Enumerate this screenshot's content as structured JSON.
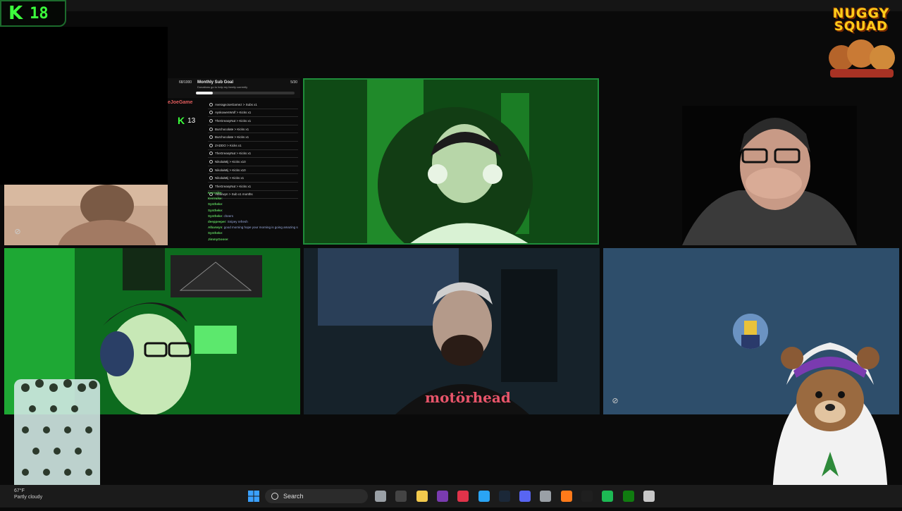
{
  "kick_badge": {
    "logo": "K",
    "value": "18"
  },
  "brand": {
    "line1": "NUGGY",
    "line2": "SQUAD"
  },
  "sub_goal": {
    "count": "68/1000",
    "title": "Monthly Sub Goal",
    "subtitle": "Donations go to help my family currently",
    "fraction": "5/30",
    "progress": 0.17
  },
  "overlay": {
    "streamer_name": "eJoeGame",
    "kicks_logo": "K",
    "kicks_count": "13"
  },
  "event_feed": [
    {
      "text": "AverageJoeGamez > Subs x1"
    },
    {
      "text": "AyskowenWolf > Kicks x1"
    },
    {
      "text": "TheGreasyNut > Kicks x1"
    },
    {
      "text": "Burchocolate > Kicks x1"
    },
    {
      "text": "Burchocolate > Kicks x1"
    },
    {
      "text": "ZADDO > Kicks x1"
    },
    {
      "text": "TheGreasyNut > Kicks x1"
    },
    {
      "text": "NikolaiMij > Kicks x10"
    },
    {
      "text": "NikolaiMij > Kicks x10"
    },
    {
      "text": "NikolaiMij > Kicks x1"
    },
    {
      "text": "TheGreasyNut > Kicks x1"
    },
    {
      "text": "Albarwyn > Sub x1 months"
    }
  ],
  "chat": [
    {
      "user": "Kerrmike",
      "text": ":"
    },
    {
      "user": "Kerrmike",
      "text": ":"
    },
    {
      "user": "Syntheke",
      "text": ":"
    },
    {
      "user": "Syntheke",
      "text": ":"
    },
    {
      "user": "Syntheke",
      "text": ": cheers"
    },
    {
      "user": "deeppeeper",
      "text": ": Snipey refresh"
    },
    {
      "user": "Albarwyn",
      "text": ": good morning hope your morning is going amazing ss"
    },
    {
      "user": "Syntheke",
      "text": ":"
    },
    {
      "user": "JimmyGoose",
      "text": ":"
    }
  ],
  "tiles": {
    "webcam_1": {
      "name": "",
      "muted_icon": "camera-off-icon"
    },
    "webcam_5": {
      "name": "",
      "muted_icon": "camera-off-icon"
    },
    "jersey_text": "motörhead"
  },
  "taskbar": {
    "weather_temp": "67°F",
    "weather_desc": "Partly cloudy",
    "search_label": "Search",
    "pinned": [
      "file-manager-icon",
      "epic-games-icon",
      "file-explorer-icon",
      "notes-icon",
      "opera-gx-icon",
      "edge-icon",
      "steam-icon",
      "discord-icon",
      "settings-icon",
      "firefox-icon",
      "obs-icon",
      "spotify-icon",
      "xbox-icon",
      "vpn-icon"
    ]
  },
  "colors": {
    "kick_green": "#3cff3c",
    "tile_border": "#1f8c3a",
    "discord_tile": "#2e4e6b",
    "taskbar": "#1b1b1b"
  }
}
